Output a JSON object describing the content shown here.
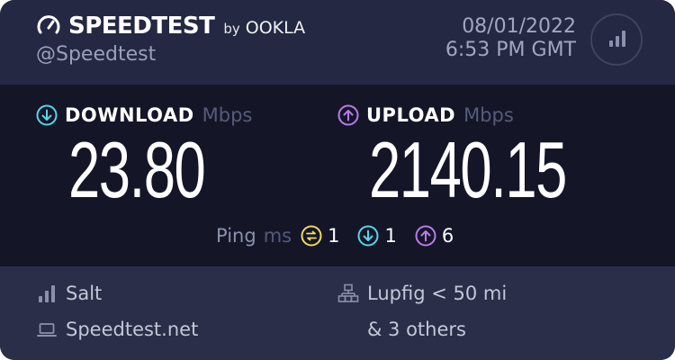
{
  "header": {
    "brand": "SPEEDTEST",
    "brand_by": "by",
    "brand_partner": "OOKLA",
    "handle": "@Speedtest",
    "date": "08/01/2022",
    "time": "6:53 PM GMT"
  },
  "download": {
    "label": "DOWNLOAD",
    "unit": "Mbps",
    "value": "23.80",
    "color": "#58d5e8"
  },
  "upload": {
    "label": "UPLOAD",
    "unit": "Mbps",
    "value": "2140.15",
    "color": "#b87ce6"
  },
  "ping": {
    "label": "Ping",
    "unit": "ms",
    "idle": "1",
    "download": "1",
    "upload": "6",
    "idle_color": "#f2d85a"
  },
  "footer": {
    "isp": "Salt",
    "site": "Speedtest.net",
    "server": "Lupfig < 50 mi",
    "others": "& 3 others"
  },
  "icons": {
    "speedometer": "speedometer-icon",
    "results": "results-bars-icon",
    "download": "download-arrow-icon",
    "upload": "upload-arrow-icon",
    "idle": "idle-latency-icon",
    "isp": "signal-bars-icon",
    "site": "laptop-icon",
    "server": "server-network-icon"
  }
}
